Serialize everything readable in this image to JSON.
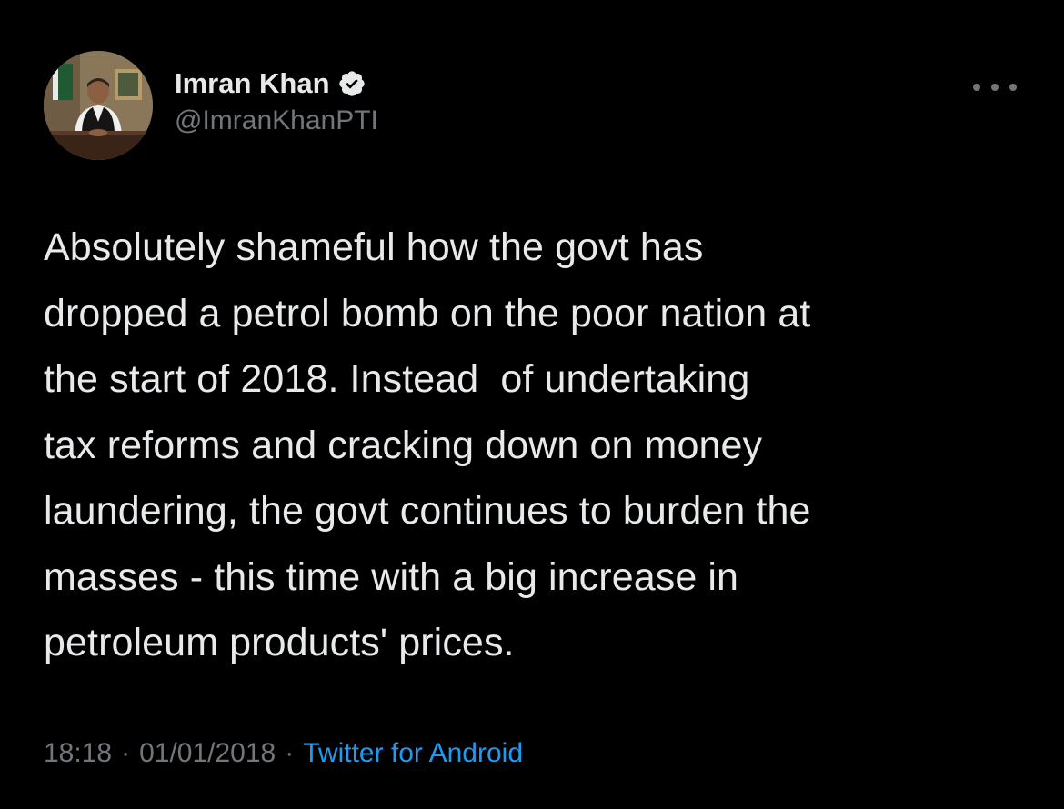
{
  "tweet": {
    "author": {
      "display_name": "Imran Khan",
      "handle": "@ImranKhanPTI",
      "verified_icon": "verified-badge-icon",
      "avatar": "profile-photo"
    },
    "more_icon": "more-horizontal-icon",
    "text_lines": [
      "Absolutely shameful how the govt has",
      "dropped a petrol bomb on the poor nation at",
      "the start of 2018. Instead  of undertaking",
      "tax reforms and cracking down on money",
      "laundering, the govt continues to burden the",
      "masses - this time with a big increase in",
      "petroleum products' prices."
    ],
    "meta": {
      "time": "18:18",
      "separator": "·",
      "date": "01/01/2018",
      "source": "Twitter for Android"
    }
  },
  "colors": {
    "background": "#000000",
    "primary_text": "#e7e9ea",
    "secondary_text": "#71767b",
    "link": "#1d9bf0"
  }
}
